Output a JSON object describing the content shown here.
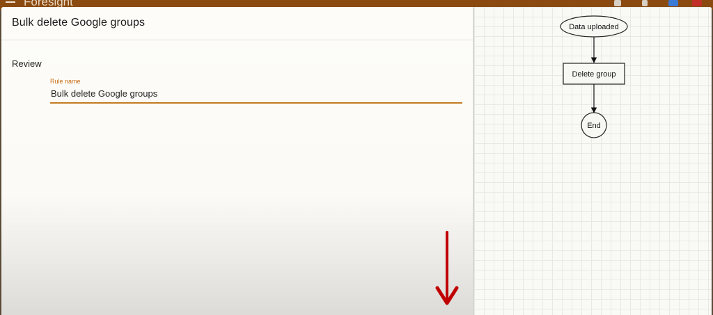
{
  "app": {
    "brand": "Foresight"
  },
  "dialog": {
    "title": "Bulk delete Google groups",
    "section_label": "Review",
    "rule_name_label": "Rule name",
    "rule_name_value": "Bulk delete Google groups"
  },
  "flow": {
    "nodes": {
      "start": "Data uploaded",
      "action": "Delete group",
      "end": "End"
    }
  },
  "colors": {
    "accent": "#c27a22",
    "appbar": "#8a4a10",
    "annotation_arrow": "#c00000"
  }
}
